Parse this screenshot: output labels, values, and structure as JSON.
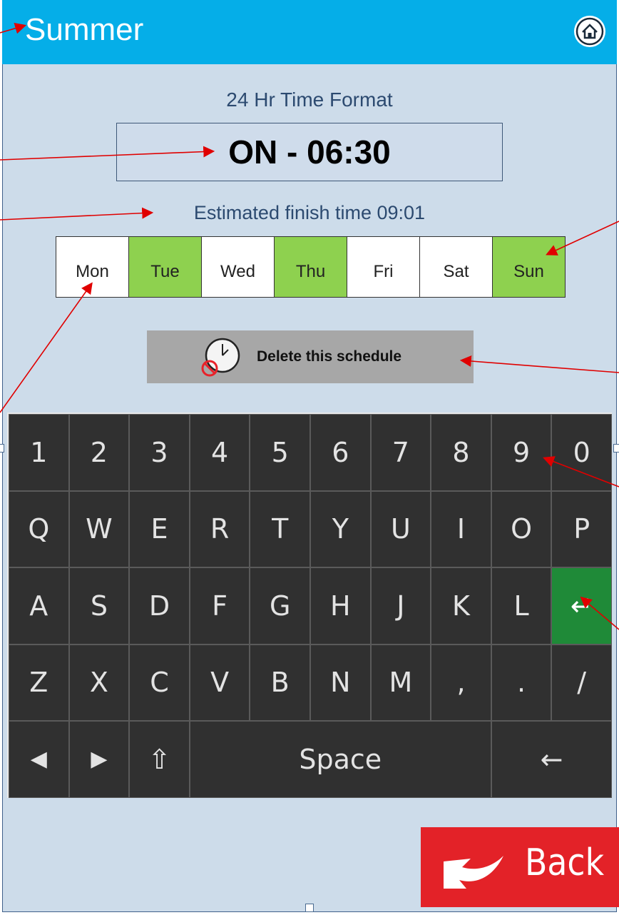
{
  "colors": {
    "header": "#05aee8",
    "background": "#cddcea",
    "day_selected": "#8ed14f",
    "day_unselected": "#ffffff",
    "delete_button": "#a7a7a7",
    "keyboard": "#303030",
    "enter_key": "#1f8a38",
    "back_button": "#e32228",
    "annotation_arrow": "#e00000"
  },
  "header": {
    "title": "Summer",
    "home_icon": "home-icon"
  },
  "time_format_label": "24 Hr Time Format",
  "time_display": "ON - 06:30",
  "finish_time": "Estimated finish time 09:01",
  "days": [
    {
      "label": "Mon",
      "selected": false
    },
    {
      "label": "Tue",
      "selected": true
    },
    {
      "label": "Wed",
      "selected": false
    },
    {
      "label": "Thu",
      "selected": true
    },
    {
      "label": "Fri",
      "selected": false
    },
    {
      "label": "Sat",
      "selected": false
    },
    {
      "label": "Sun",
      "selected": true
    }
  ],
  "delete_button": {
    "label": "Delete this schedule",
    "icon": "clock-delete-icon"
  },
  "keyboard": {
    "row1": [
      "1",
      "2",
      "3",
      "4",
      "5",
      "6",
      "7",
      "8",
      "9",
      "0"
    ],
    "row2": [
      "Q",
      "W",
      "E",
      "R",
      "T",
      "Y",
      "U",
      "I",
      "O",
      "P"
    ],
    "row3": [
      "A",
      "S",
      "D",
      "F",
      "G",
      "H",
      "J",
      "K",
      "L",
      "↵"
    ],
    "row4": [
      "Z",
      "X",
      "C",
      "V",
      "B",
      "N",
      "M",
      ",",
      ".",
      "/"
    ],
    "row5": {
      "left": "◀",
      "right": "▶",
      "shift": "⇧",
      "space": "Space",
      "backspace": "←"
    }
  },
  "back_button": {
    "label": "Back",
    "icon": "back-arrow-icon"
  }
}
